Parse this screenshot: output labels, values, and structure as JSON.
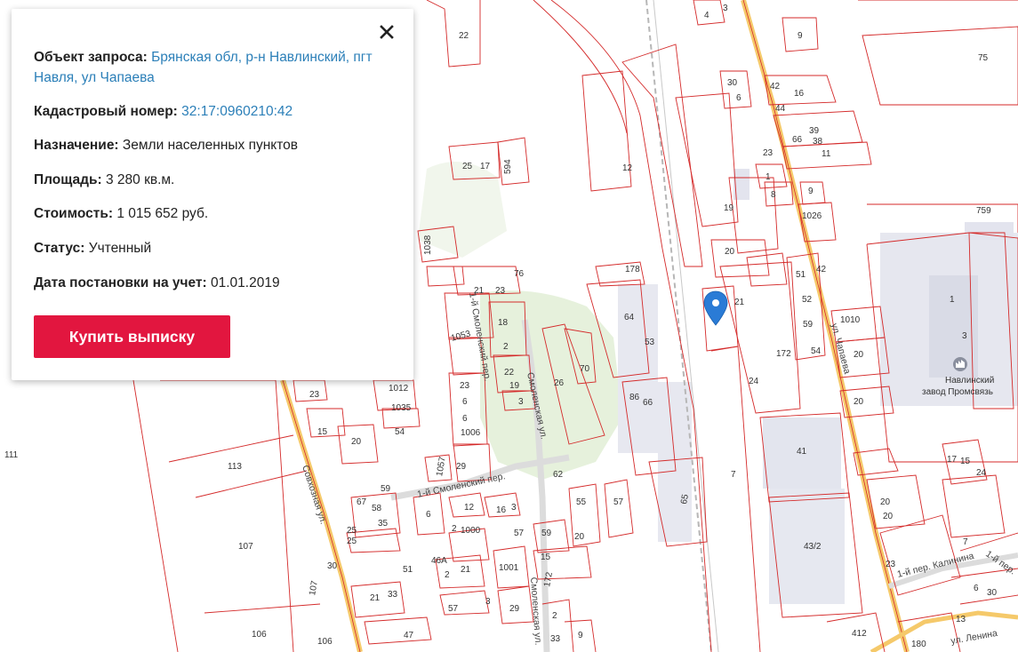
{
  "info_panel": {
    "object_label": "Объект запроса:",
    "object_value": "Брянская обл, р-н Навлинский, пгт Навля, ул Чапаева",
    "cadastral_label": "Кадастровый номер:",
    "cadastral_value": "32:17:0960210:42",
    "purpose_label": "Назначение:",
    "purpose_value": "Земли населенных пунктов",
    "area_label": "Площадь:",
    "area_value": "3 280 кв.м.",
    "cost_label": "Стоимость:",
    "cost_value": "1 015 652 руб.",
    "status_label": "Статус:",
    "status_value": "Учтенный",
    "date_label": "Дата постановки на учет:",
    "date_value": "01.01.2019",
    "buy_button": "Купить выписку",
    "close_icon": "close-icon"
  },
  "map": {
    "streets": {
      "sovkhoznaya": "Совхозная ул.",
      "smolensky_lane": "1-й Смоленский пер.",
      "smolenskaya_1": "Смоленская ул.",
      "smolenskaya_2": "Смоленская ул.",
      "smolensky_per": "1-й Смоленский пер.",
      "chapaeva": "ул. Чапаева",
      "kalinina": "1-й пер. Калинина",
      "lenina": "ул. Ленина",
      "kalinina_2": "1-й пер."
    },
    "poi": {
      "factory_line1": "Навлинский",
      "factory_line2": "завод Промсвязь"
    },
    "marker_icon": "map-pin-icon",
    "factory_icon": "factory-icon",
    "colors": {
      "boundary": "#d42a2a",
      "main_road": "#f5c96a",
      "marker": "#2a7bd6",
      "button": "#e2163f",
      "link": "#2b7fb8"
    },
    "parcel_numbers": [
      {
        "t": "4"
      },
      {
        "t": "3"
      },
      {
        "t": "22"
      },
      {
        "t": "9"
      },
      {
        "t": "75"
      },
      {
        "t": "30"
      },
      {
        "t": "42"
      },
      {
        "t": "16"
      },
      {
        "t": "6"
      },
      {
        "t": "44"
      },
      {
        "t": "39"
      },
      {
        "t": "66"
      },
      {
        "t": "38"
      },
      {
        "t": "11"
      },
      {
        "t": "23"
      },
      {
        "t": "1"
      },
      {
        "t": "8"
      },
      {
        "t": "9"
      },
      {
        "t": "1026"
      },
      {
        "t": "759"
      },
      {
        "t": "12"
      },
      {
        "t": "19"
      },
      {
        "t": "594"
      },
      {
        "t": "25"
      },
      {
        "t": "17"
      },
      {
        "t": "20"
      },
      {
        "t": "42"
      },
      {
        "t": "1038"
      },
      {
        "t": "178"
      },
      {
        "t": "21"
      },
      {
        "t": "51"
      },
      {
        "t": "52"
      },
      {
        "t": "1010"
      },
      {
        "t": "1"
      },
      {
        "t": "76"
      },
      {
        "t": "21"
      },
      {
        "t": "23"
      },
      {
        "t": "18"
      },
      {
        "t": "1053"
      },
      {
        "t": "64"
      },
      {
        "t": "53"
      },
      {
        "t": "3"
      },
      {
        "t": "2"
      },
      {
        "t": "59"
      },
      {
        "t": "172"
      },
      {
        "t": "54"
      },
      {
        "t": "20"
      },
      {
        "t": "70"
      },
      {
        "t": "22"
      },
      {
        "t": "19"
      },
      {
        "t": "26"
      },
      {
        "t": "24"
      },
      {
        "t": "1012"
      },
      {
        "t": "23"
      },
      {
        "t": "1035"
      },
      {
        "t": "6"
      },
      {
        "t": "66"
      },
      {
        "t": "20"
      },
      {
        "t": "6"
      },
      {
        "t": "3"
      },
      {
        "t": "86"
      },
      {
        "t": "23"
      },
      {
        "t": "15"
      },
      {
        "t": "54"
      },
      {
        "t": "1006"
      },
      {
        "t": "20"
      },
      {
        "t": "41"
      },
      {
        "t": "111"
      },
      {
        "t": "113"
      },
      {
        "t": "1057"
      },
      {
        "t": "29"
      },
      {
        "t": "17"
      },
      {
        "t": "62"
      },
      {
        "t": "7"
      },
      {
        "t": "59"
      },
      {
        "t": "65"
      },
      {
        "t": "15"
      },
      {
        "t": "24"
      },
      {
        "t": "67"
      },
      {
        "t": "12"
      },
      {
        "t": "16"
      },
      {
        "t": "3"
      },
      {
        "t": "55"
      },
      {
        "t": "57"
      },
      {
        "t": "20"
      },
      {
        "t": "58"
      },
      {
        "t": "6"
      },
      {
        "t": "35"
      },
      {
        "t": "2"
      },
      {
        "t": "1000"
      },
      {
        "t": "57"
      },
      {
        "t": "59"
      },
      {
        "t": "20"
      },
      {
        "t": "25"
      },
      {
        "t": "107"
      },
      {
        "t": "25"
      },
      {
        "t": "15"
      },
      {
        "t": "51"
      },
      {
        "t": "21"
      },
      {
        "t": "43/2"
      },
      {
        "t": "46А"
      },
      {
        "t": "1001"
      },
      {
        "t": "23"
      },
      {
        "t": "30"
      },
      {
        "t": "2"
      },
      {
        "t": "172"
      },
      {
        "t": "107"
      },
      {
        "t": "33"
      },
      {
        "t": "21"
      },
      {
        "t": "57"
      },
      {
        "t": "3"
      },
      {
        "t": "29"
      },
      {
        "t": "2"
      },
      {
        "t": "47"
      },
      {
        "t": "33"
      },
      {
        "t": "106"
      },
      {
        "t": "106"
      },
      {
        "t": "412"
      },
      {
        "t": "180"
      },
      {
        "t": "9"
      },
      {
        "t": "13"
      },
      {
        "t": "20"
      },
      {
        "t": "7"
      },
      {
        "t": "6"
      },
      {
        "t": "30"
      }
    ]
  }
}
